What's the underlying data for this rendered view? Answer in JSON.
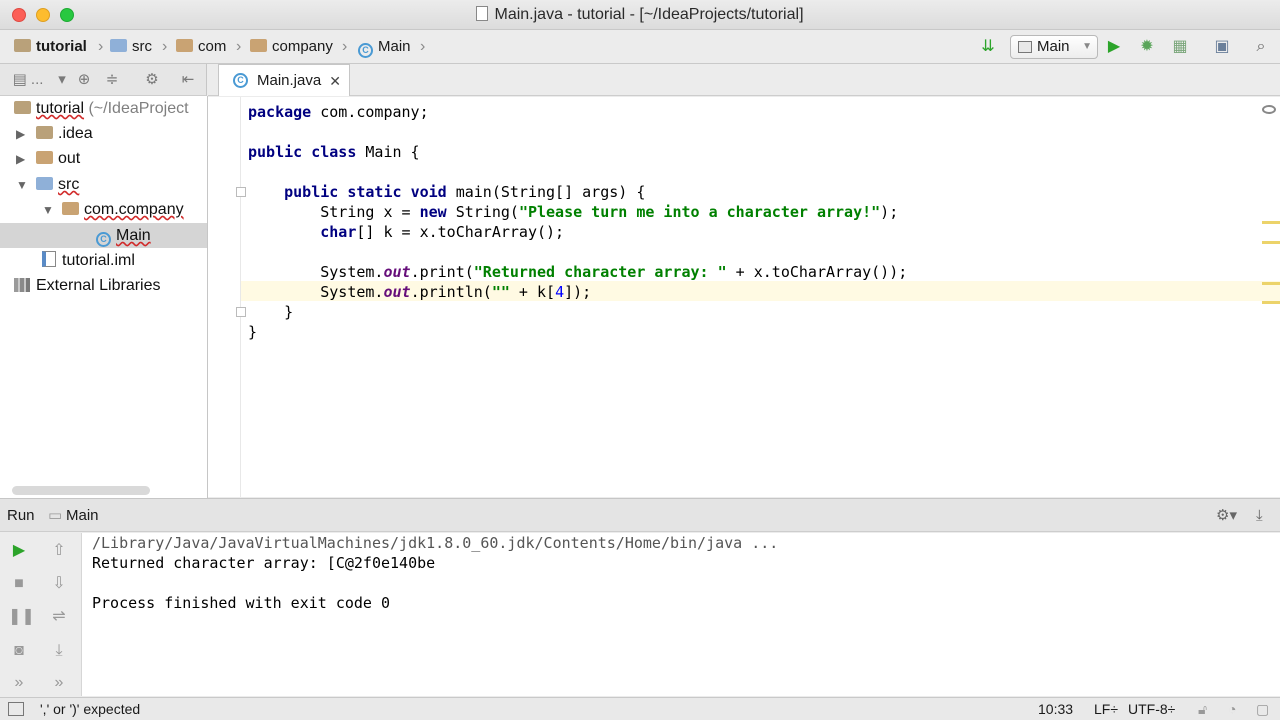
{
  "window": {
    "title": "Main.java - tutorial - [~/IdeaProjects/tutorial]"
  },
  "navbar": {
    "crumbs": [
      "tutorial",
      "src",
      "com",
      "company",
      "Main"
    ],
    "run_config": "Main",
    "icons": [
      "build-icon",
      "run-icon",
      "debug-icon",
      "coverage-icon",
      "project-structure-icon",
      "search-icon"
    ]
  },
  "project_panel": {
    "toolbar_label": "...",
    "tree": [
      {
        "label": "tutorial",
        "suffix": " (~/IdeaProject",
        "level": 0,
        "expanded": true
      },
      {
        "label": ".idea",
        "level": 1,
        "expanded": false
      },
      {
        "label": "out",
        "level": 1,
        "expanded": false
      },
      {
        "label": "src",
        "level": 1,
        "expanded": true
      },
      {
        "label": "com.company",
        "level": 2,
        "expanded": true
      },
      {
        "label": "Main",
        "level": 3,
        "selected": true
      },
      {
        "label": "tutorial.iml",
        "level": 1
      },
      {
        "label": "External Libraries",
        "level": 0
      }
    ]
  },
  "editor": {
    "tab_label": "Main.java",
    "lines": [
      "package com.company;",
      "",
      "public class Main {",
      "",
      "    public static void main(String[] args) {",
      "        String x = new String(\"Please turn me into a character array!\");",
      "        char[] k = x.toCharArray();",
      "",
      "        System.out.print(\"Returned character array: \" + x.toCharArray());",
      "        System.out.println(\"\" + k[4]);",
      "    }",
      "}"
    ]
  },
  "run_panel": {
    "title": "Run",
    "config": "Main",
    "output": [
      "/Library/Java/JavaVirtualMachines/jdk1.8.0_60.jdk/Contents/Home/bin/java ...",
      "Returned character array: [C@2f0e140be",
      "",
      "Process finished with exit code 0"
    ]
  },
  "status_bar": {
    "message": "',' or ')' expected",
    "position": "10:33",
    "line_sep": "LF÷",
    "encoding": "UTF-8÷"
  },
  "colors": {
    "keyword": "#000080",
    "string": "#008000",
    "field": "#660e7a",
    "number": "#0000ff",
    "run_green": "#2ca42a"
  }
}
